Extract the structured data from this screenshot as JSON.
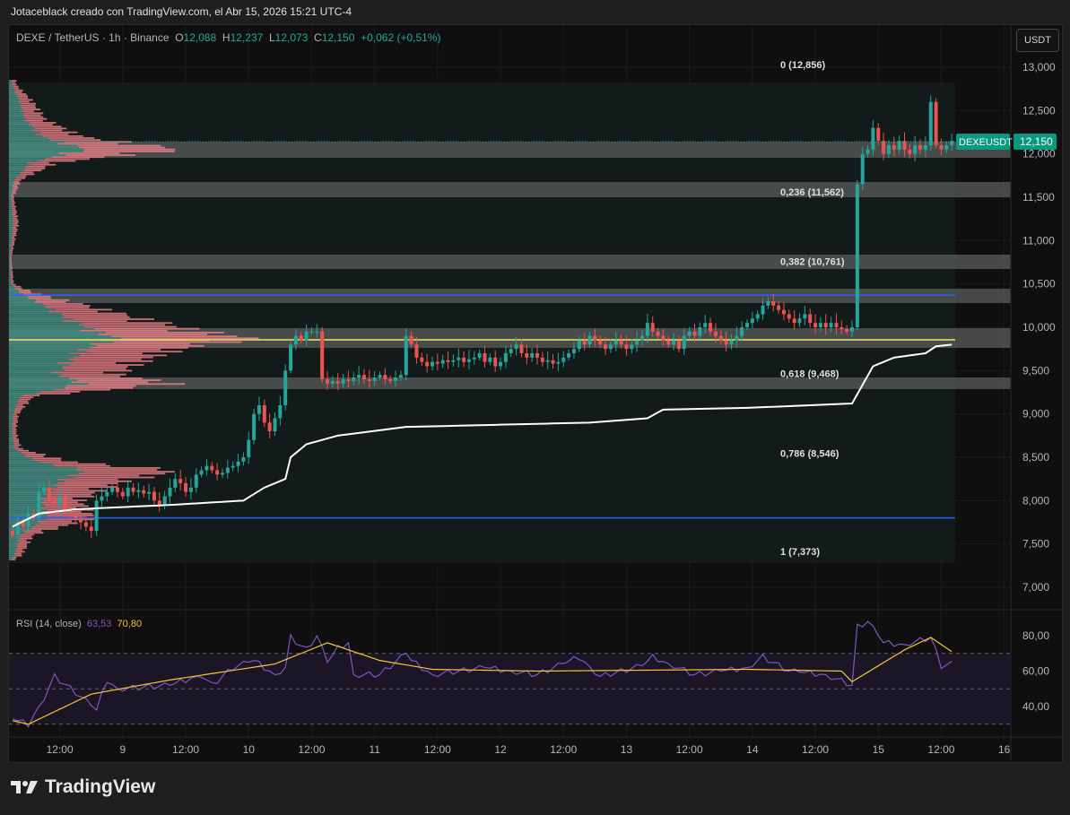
{
  "header": {
    "credit": "Jotaceblack creado con TradingView.com, el Abr 15, 2026 15:21 UTC-4"
  },
  "legend": {
    "symbol": "DEXE / TetherUS · 1h · Binance",
    "o_label": "O",
    "o": "12,088",
    "h_label": "H",
    "h": "12,237",
    "l_label": "L",
    "l": "12,073",
    "c_label": "C",
    "c": "12,150",
    "change": "+0,062 (+0,51%)"
  },
  "currency_button": "USDT",
  "price_tag": {
    "symbol": "DEXEUSDT",
    "value": "12,150"
  },
  "rsi_legend": {
    "name": "RSI (14, close)",
    "rsi": "63,53",
    "ma": "70,80"
  },
  "footer": {
    "brand": "TradingView"
  },
  "colors": {
    "up": "#26a69a",
    "down": "#ef5350",
    "rsi": "#7e57c2",
    "rsi_ma": "#f7c531",
    "vwap": "#ffffff",
    "blue_line": "#2962ff",
    "yellow_line": "#f7e463",
    "tag": "#089981"
  },
  "chart_data": {
    "type": "candlestick",
    "price_axis": {
      "ylim": [
        7000,
        13000
      ],
      "ticks": [
        13000,
        12500,
        12000,
        11500,
        11000,
        10500,
        10000,
        9500,
        9000,
        8500,
        8000,
        7500,
        7000
      ],
      "tick_labels": [
        "13,000",
        "12,500",
        "12,000",
        "11,500",
        "11,000",
        "10,500",
        "10,000",
        "9,500",
        "9,000",
        "8,500",
        "8,000",
        "7,500",
        "7,000"
      ]
    },
    "time_axis": {
      "interval": "1h",
      "ticks": [
        {
          "index": 9,
          "label": "12:00"
        },
        {
          "index": 21,
          "label": "9"
        },
        {
          "index": 33,
          "label": "12:00"
        },
        {
          "index": 45,
          "label": "10"
        },
        {
          "index": 57,
          "label": "12:00"
        },
        {
          "index": 69,
          "label": "11"
        },
        {
          "index": 81,
          "label": "12:00"
        },
        {
          "index": 93,
          "label": "12"
        },
        {
          "index": 105,
          "label": "12:00"
        },
        {
          "index": 117,
          "label": "13"
        },
        {
          "index": 129,
          "label": "12:00"
        },
        {
          "index": 141,
          "label": "14"
        },
        {
          "index": 153,
          "label": "12:00"
        },
        {
          "index": 165,
          "label": "15"
        },
        {
          "index": 177,
          "label": "12:00"
        },
        {
          "index": 189,
          "label": "16"
        }
      ]
    },
    "first_open": 7650,
    "closes": [
      7600,
      7750,
      7700,
      7850,
      7800,
      8100,
      8150,
      8000,
      7950,
      8050,
      7900,
      7850,
      7800,
      7750,
      7700,
      7650,
      8000,
      8050,
      8100,
      8150,
      8100,
      8050,
      8150,
      8100,
      8120,
      8080,
      8100,
      8000,
      7950,
      8050,
      8150,
      8250,
      8200,
      8100,
      8150,
      8300,
      8350,
      8400,
      8350,
      8300,
      8320,
      8380,
      8400,
      8450,
      8500,
      8700,
      9000,
      9100,
      8900,
      8800,
      8950,
      9100,
      9500,
      9800,
      9900,
      9850,
      9950,
      9950,
      9950,
      9400,
      9350,
      9380,
      9350,
      9400,
      9380,
      9420,
      9450,
      9400,
      9380,
      9420,
      9450,
      9400,
      9380,
      9420,
      9450,
      9900,
      9800,
      9650,
      9600,
      9550,
      9600,
      9580,
      9620,
      9600,
      9620,
      9650,
      9600,
      9630,
      9650,
      9700,
      9600,
      9650,
      9550,
      9600,
      9700,
      9750,
      9800,
      9700,
      9650,
      9700,
      9650,
      9600,
      9620,
      9580,
      9600,
      9650,
      9700,
      9750,
      9850,
      9800,
      9900,
      9850,
      9800,
      9750,
      9800,
      9850,
      9800,
      9750,
      9800,
      9850,
      9900,
      10050,
      9950,
      9900,
      9850,
      9800,
      9850,
      9750,
      9900,
      9950,
      9900,
      10000,
      10050,
      9950,
      9900,
      9850,
      9800,
      9850,
      9900,
      10000,
      10050,
      10100,
      10150,
      10250,
      10300,
      10250,
      10200,
      10150,
      10100,
      10050,
      10100,
      10150,
      10050,
      10000,
      10050,
      10000,
      10050,
      10000,
      9980,
      9950,
      10000,
      11650,
      12000,
      12050,
      12300,
      12150,
      12000,
      12100,
      12050,
      12150,
      12050,
      12000,
      12100,
      12050,
      12100,
      12600,
      12100,
      12050,
      12100,
      12150
    ],
    "vwap_keypoints": [
      [
        0,
        7700
      ],
      [
        5,
        7850
      ],
      [
        12,
        7900
      ],
      [
        30,
        7950
      ],
      [
        44,
        8000
      ],
      [
        48,
        8150
      ],
      [
        52,
        8250
      ],
      [
        53,
        8500
      ],
      [
        56,
        8650
      ],
      [
        62,
        8750
      ],
      [
        75,
        8850
      ],
      [
        110,
        8900
      ],
      [
        121,
        8950
      ],
      [
        124,
        9050
      ],
      [
        140,
        9070
      ],
      [
        160,
        9120
      ],
      [
        164,
        9550
      ],
      [
        168,
        9650
      ],
      [
        174,
        9700
      ],
      [
        176,
        9780
      ],
      [
        179,
        9800
      ]
    ],
    "fib_levels": [
      {
        "ratio": "0",
        "price": 12856,
        "label": "0 (12,856)"
      },
      {
        "ratio": "0,236",
        "price": 11562,
        "label": "0,236 (11,562)"
      },
      {
        "ratio": "0,382",
        "price": 10761,
        "label": "0,382 (10,761)"
      },
      {
        "ratio": "0,618",
        "price": 9468,
        "label": "0,618 (9,468)"
      },
      {
        "ratio": "0,786",
        "price": 8546,
        "label": "0,786 (8,546)"
      },
      {
        "ratio": "1",
        "price": 7373,
        "label": "1 (7,373)"
      }
    ],
    "zones": [
      [
        11955,
        12141
      ],
      [
        11500,
        11676
      ],
      [
        10672,
        10838
      ],
      [
        10279,
        10445
      ],
      [
        9762,
        9990
      ],
      [
        9287,
        9421
      ]
    ],
    "horizontal_lines": [
      {
        "price": 10370,
        "color": "blue"
      },
      {
        "price": 9855,
        "color": "yellow"
      },
      {
        "price": 7800,
        "color": "blue"
      }
    ],
    "volume_profile": [
      [
        7350,
        0.05
      ],
      [
        7600,
        0.1
      ],
      [
        7800,
        0.35
      ],
      [
        8000,
        0.3
      ],
      [
        8200,
        0.45
      ],
      [
        8350,
        0.7
      ],
      [
        8450,
        0.25
      ],
      [
        8600,
        0.05
      ],
      [
        8800,
        0.03
      ],
      [
        9000,
        0.04
      ],
      [
        9200,
        0.1
      ],
      [
        9350,
        0.7
      ],
      [
        9450,
        0.45
      ],
      [
        9600,
        0.55
      ],
      [
        9750,
        0.7
      ],
      [
        9870,
        1.0
      ],
      [
        9950,
        0.8
      ],
      [
        10100,
        0.55
      ],
      [
        10300,
        0.25
      ],
      [
        10400,
        0.1
      ],
      [
        10500,
        0.02
      ],
      [
        10800,
        0.01
      ],
      [
        11200,
        0.04
      ],
      [
        11500,
        0.02
      ],
      [
        11700,
        0.05
      ],
      [
        11900,
        0.2
      ],
      [
        12050,
        0.72
      ],
      [
        12200,
        0.3
      ],
      [
        12400,
        0.15
      ],
      [
        12600,
        0.1
      ],
      [
        12800,
        0.03
      ]
    ],
    "rsi": {
      "ylim": [
        30,
        85
      ],
      "ticks": [
        80,
        60,
        40
      ],
      "tick_labels": [
        "80,00",
        "60,00",
        "40,00"
      ],
      "bands": [
        70,
        50,
        30
      ],
      "keypoints": [
        [
          0,
          33
        ],
        [
          3,
          30
        ],
        [
          6,
          45
        ],
        [
          8,
          57
        ],
        [
          12,
          48
        ],
        [
          16,
          38
        ],
        [
          18,
          55
        ],
        [
          20,
          50
        ],
        [
          30,
          52
        ],
        [
          36,
          58
        ],
        [
          38,
          52
        ],
        [
          42,
          62
        ],
        [
          46,
          66
        ],
        [
          50,
          58
        ],
        [
          52,
          62
        ],
        [
          53,
          79
        ],
        [
          56,
          72
        ],
        [
          58,
          80
        ],
        [
          60,
          65
        ],
        [
          62,
          73
        ],
        [
          64,
          76
        ],
        [
          65,
          58
        ],
        [
          70,
          58
        ],
        [
          75,
          70
        ],
        [
          76,
          66
        ],
        [
          80,
          58
        ],
        [
          90,
          62
        ],
        [
          100,
          58
        ],
        [
          108,
          68
        ],
        [
          112,
          57
        ],
        [
          120,
          63
        ],
        [
          122,
          68
        ],
        [
          130,
          58
        ],
        [
          140,
          62
        ],
        [
          143,
          68
        ],
        [
          148,
          60
        ],
        [
          155,
          58
        ],
        [
          160,
          52
        ],
        [
          161,
          85
        ],
        [
          163,
          88
        ],
        [
          166,
          76
        ],
        [
          170,
          75
        ],
        [
          175,
          79
        ],
        [
          177,
          63
        ],
        [
          179,
          64
        ]
      ],
      "ma_keypoints": [
        [
          0,
          32
        ],
        [
          3,
          30
        ],
        [
          15,
          47
        ],
        [
          30,
          55
        ],
        [
          50,
          64
        ],
        [
          60,
          76
        ],
        [
          70,
          66
        ],
        [
          80,
          61
        ],
        [
          100,
          60
        ],
        [
          140,
          61
        ],
        [
          158,
          60
        ],
        [
          160,
          54
        ],
        [
          170,
          72
        ],
        [
          175,
          79
        ],
        [
          179,
          71
        ]
      ]
    }
  }
}
